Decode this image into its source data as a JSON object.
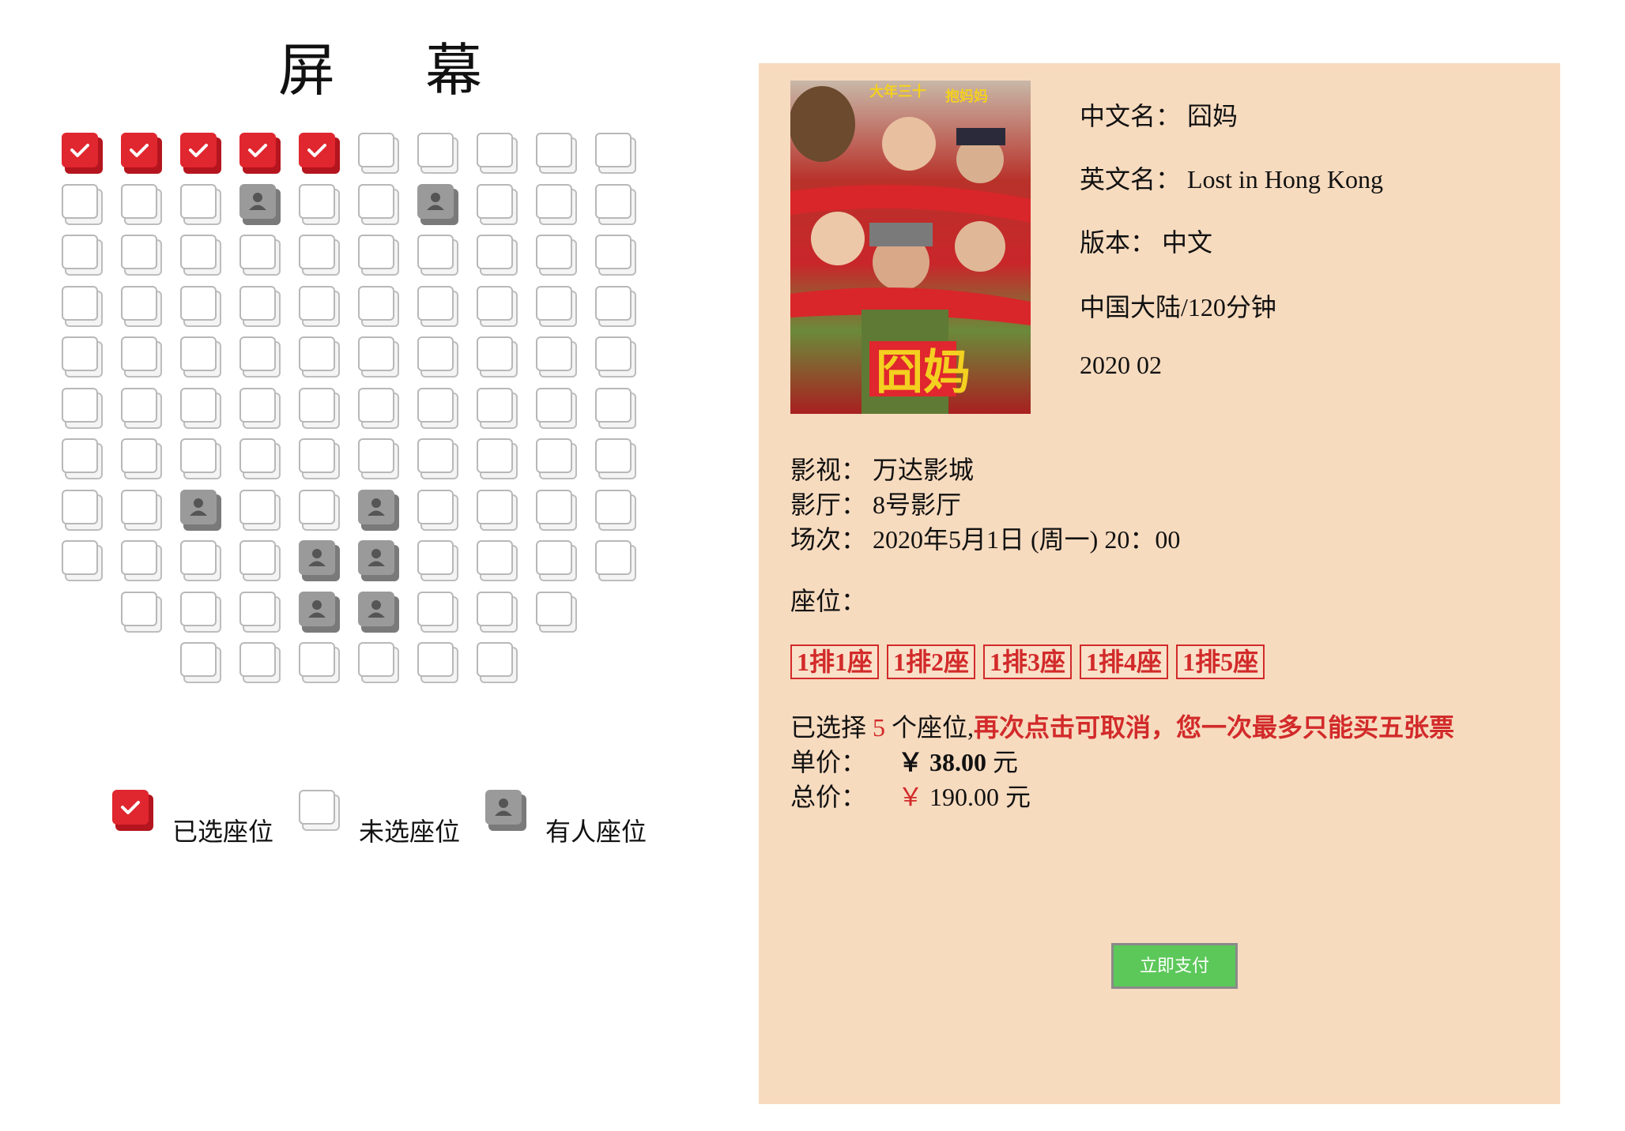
{
  "screen": {
    "title": "屏 幕"
  },
  "seat_map": {
    "rows": [
      {
        "row": 1,
        "seats": [
          "selected",
          "selected",
          "selected",
          "selected",
          "selected",
          "free",
          "free",
          "free",
          "free",
          "free"
        ]
      },
      {
        "row": 2,
        "seats": [
          "free",
          "free",
          "free",
          "taken",
          "free",
          "free",
          "taken",
          "free",
          "free",
          "free"
        ]
      },
      {
        "row": 3,
        "seats": [
          "free",
          "free",
          "free",
          "free",
          "free",
          "free",
          "free",
          "free",
          "free",
          "free"
        ]
      },
      {
        "row": 4,
        "seats": [
          "free",
          "free",
          "free",
          "free",
          "free",
          "free",
          "free",
          "free",
          "free",
          "free"
        ]
      },
      {
        "row": 5,
        "seats": [
          "free",
          "free",
          "free",
          "free",
          "free",
          "free",
          "free",
          "free",
          "free",
          "free"
        ]
      },
      {
        "row": 6,
        "seats": [
          "free",
          "free",
          "free",
          "free",
          "free",
          "free",
          "free",
          "free",
          "free",
          "free"
        ]
      },
      {
        "row": 7,
        "seats": [
          "free",
          "free",
          "free",
          "free",
          "free",
          "free",
          "free",
          "free",
          "free",
          "free"
        ]
      },
      {
        "row": 8,
        "seats": [
          "free",
          "free",
          "taken",
          "free",
          "free",
          "taken",
          "free",
          "free",
          "free",
          "free"
        ]
      },
      {
        "row": 9,
        "seats": [
          "free",
          "free",
          "free",
          "free",
          "taken",
          "taken",
          "free",
          "free",
          "free",
          "free"
        ]
      },
      {
        "row": 10,
        "seats": [
          null,
          "free",
          "free",
          "free",
          "taken",
          "taken",
          "free",
          "free",
          "free",
          null
        ]
      },
      {
        "row": 11,
        "seats": [
          null,
          null,
          "free",
          "free",
          "free",
          "free",
          "free",
          "free",
          null,
          null
        ]
      }
    ]
  },
  "legend": {
    "selected_label": "已选座位",
    "free_label": "未选座位",
    "taken_label": "有人座位"
  },
  "movie": {
    "chinese_name": "中文名：  囧妈",
    "english_name": "英文名：  Lost in Hong Kong",
    "version": "版本：  中文",
    "region_duration": "中国大陆/120分钟",
    "release": "2020 02"
  },
  "booking": {
    "cinema": "影视：  万达影城",
    "hall": "影厅：  8号影厅",
    "showtime": "场次：  2020年5月1日 (周一) 20：00",
    "seats_label": "座位：",
    "selected_seats": [
      "1排1座",
      "1排2座",
      "1排3座",
      "1排4座",
      "1排5座"
    ],
    "selected_prefix": "已选择",
    "selected_count": "5",
    "selected_suffix": "个座位,",
    "hint": "再次点击可取消，您一次最多只能买五张票",
    "unit_price_label": "单价：",
    "unit_price_value": "￥  38.00",
    "unit_price_unit": "元",
    "total_price_label": "总价：",
    "total_price_symbol": "￥",
    "total_price_value": "190.00 元",
    "pay_button": "立即支付"
  },
  "colors": {
    "panel_bg": "#f7dbbf",
    "selected_red": "#e0262e",
    "taken_gray": "#9a9a9a",
    "pay_green": "#5cc85a"
  }
}
